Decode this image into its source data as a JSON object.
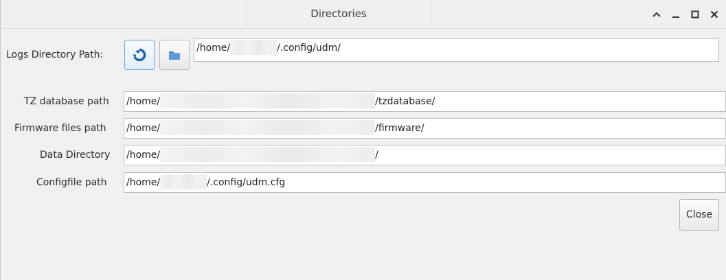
{
  "window": {
    "title": "Directories",
    "controls": {
      "shade": "^",
      "minimize": "_",
      "maximize": "□",
      "close": "×"
    }
  },
  "logs": {
    "label": "Logs Directory Path:",
    "reset_icon": "reset-icon",
    "folder_icon": "folder-icon",
    "value_prefix": "/home/",
    "value_suffix": "/.config/udm/"
  },
  "fields": [
    {
      "label": "TZ database path",
      "prefix": "/home/",
      "suffix": "/tzdatabase/"
    },
    {
      "label": "Firmware files path",
      "prefix": "/home/",
      "suffix": "/firmware/"
    },
    {
      "label": "Data Directory",
      "prefix": "/home/",
      "suffix": "/"
    },
    {
      "label": "Configfile path",
      "prefix": "/home/",
      "suffix": "/.config/udm.cfg"
    }
  ],
  "actions": {
    "close_label": "Close"
  },
  "colors": {
    "active_border": "#6aa0d8",
    "folder_blue": "#3f7cc9",
    "reset_blue": "#1f5fa0"
  }
}
